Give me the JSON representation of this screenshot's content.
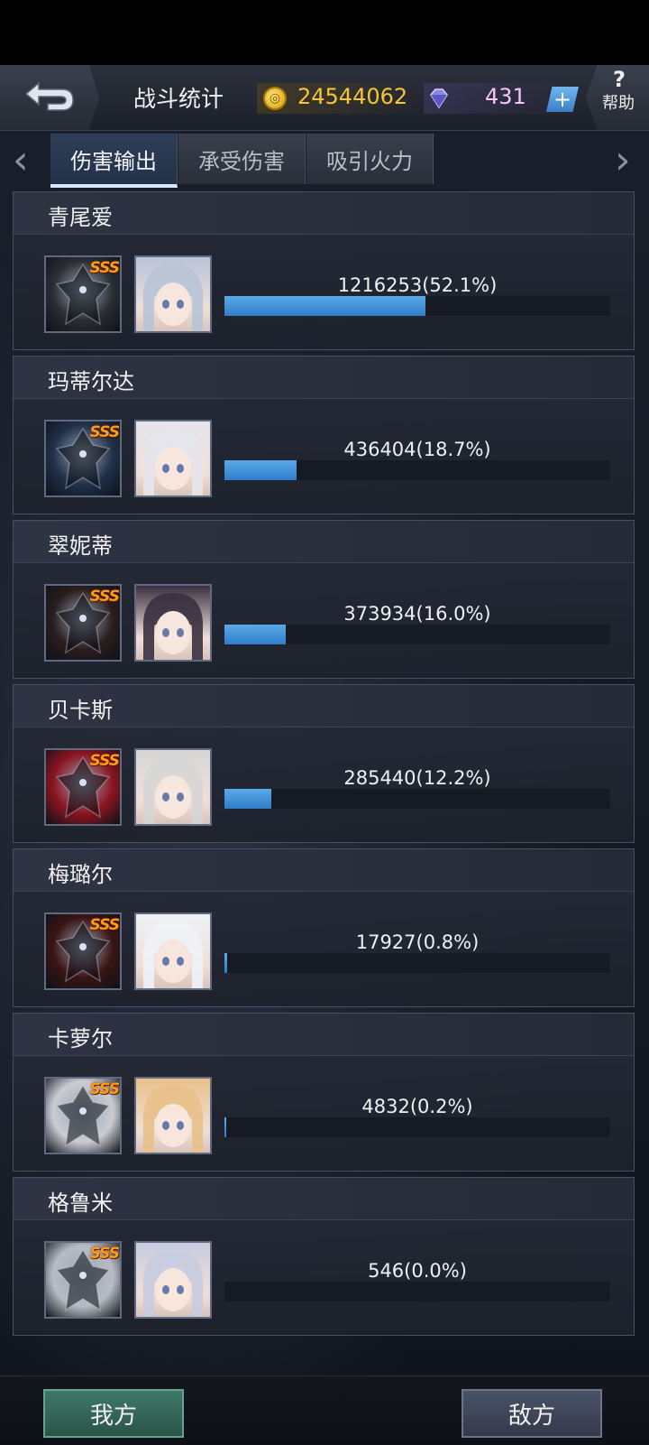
{
  "header": {
    "title": "战斗统计",
    "gold": "24544062",
    "gems": "431",
    "help_label": "帮助",
    "help_symbol": "?",
    "plus_symbol": "+"
  },
  "tabs": [
    {
      "label": "伤害输出",
      "active": true
    },
    {
      "label": "承受伤害",
      "active": false
    },
    {
      "label": "吸引火力",
      "active": false
    }
  ],
  "arrows": {
    "left": "‹",
    "right": "›"
  },
  "rank_badge": "SSS",
  "players": [
    {
      "name": "青尾爱",
      "damage": "1216253(52.1%)",
      "percent": 52.1,
      "mecha_color": "#2a2d33",
      "pilot_color": "#b8c4d8"
    },
    {
      "name": "玛蒂尔达",
      "damage": "436404(18.7%)",
      "percent": 18.7,
      "mecha_color": "#1f3048",
      "pilot_color": "#e5e5ec"
    },
    {
      "name": "翠妮蒂",
      "damage": "373934(16.0%)",
      "percent": 16.0,
      "mecha_color": "#2a1d1d",
      "pilot_color": "#3a3040"
    },
    {
      "name": "贝卡斯",
      "damage": "285440(12.2%)",
      "percent": 12.2,
      "mecha_color": "#8a1420",
      "pilot_color": "#d6d6d6"
    },
    {
      "name": "梅璐尔",
      "damage": "17927(0.8%)",
      "percent": 0.8,
      "mecha_color": "#3a1414",
      "pilot_color": "#eef2f6"
    },
    {
      "name": "卡萝尔",
      "damage": "4832(0.2%)",
      "percent": 0.2,
      "mecha_color": "#c9ccd2",
      "pilot_color": "#e8c08a"
    },
    {
      "name": "格鲁米",
      "damage": "546(0.0%)",
      "percent": 0.0,
      "mecha_color": "#b8bcc4",
      "pilot_color": "#c8cce0"
    }
  ],
  "bottom": {
    "mine_label": "我方",
    "enemy_label": "敌方"
  }
}
